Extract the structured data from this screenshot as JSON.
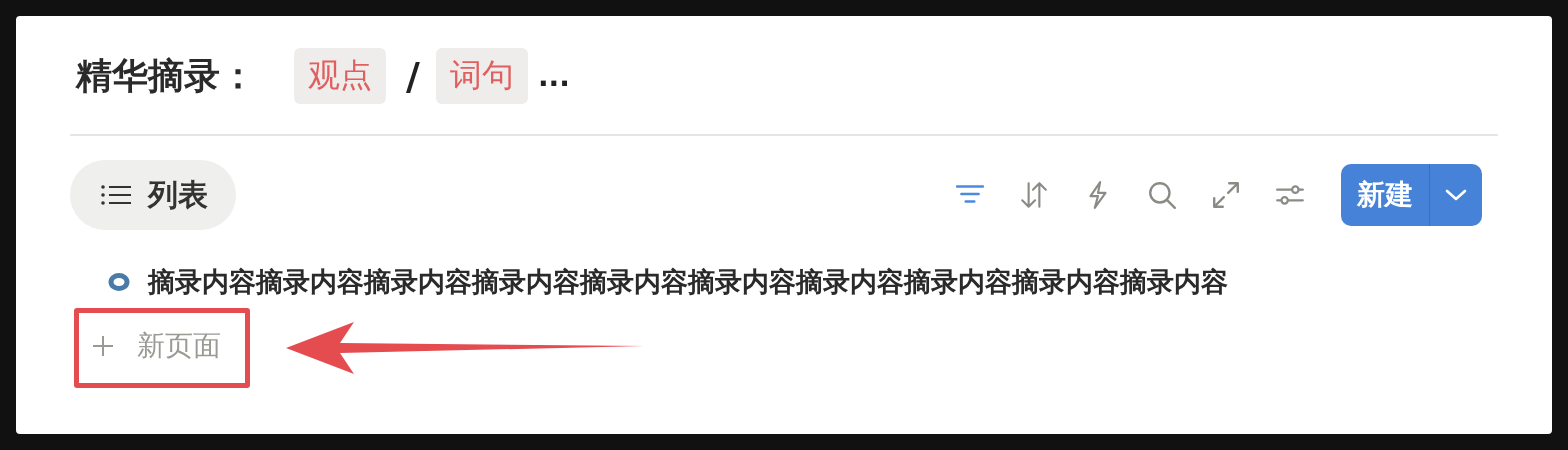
{
  "header": {
    "title": "精华摘录：",
    "tags": [
      "观点",
      "词句"
    ],
    "separator": "/",
    "ellipsis": "..."
  },
  "view_tab": {
    "label": "列表"
  },
  "tools": [
    {
      "kind": "filter",
      "active": true
    },
    {
      "kind": "sort",
      "active": false
    },
    {
      "kind": "automation",
      "active": false
    },
    {
      "kind": "search",
      "active": false
    },
    {
      "kind": "expand",
      "active": false
    },
    {
      "kind": "settings",
      "active": false
    }
  ],
  "new_button": {
    "label": "新建"
  },
  "items": [
    {
      "title": "摘录内容摘录内容摘录内容摘录内容摘录内容摘录内容摘录内容摘录内容摘录内容摘录内容"
    }
  ],
  "new_page": {
    "label": "新页面"
  }
}
